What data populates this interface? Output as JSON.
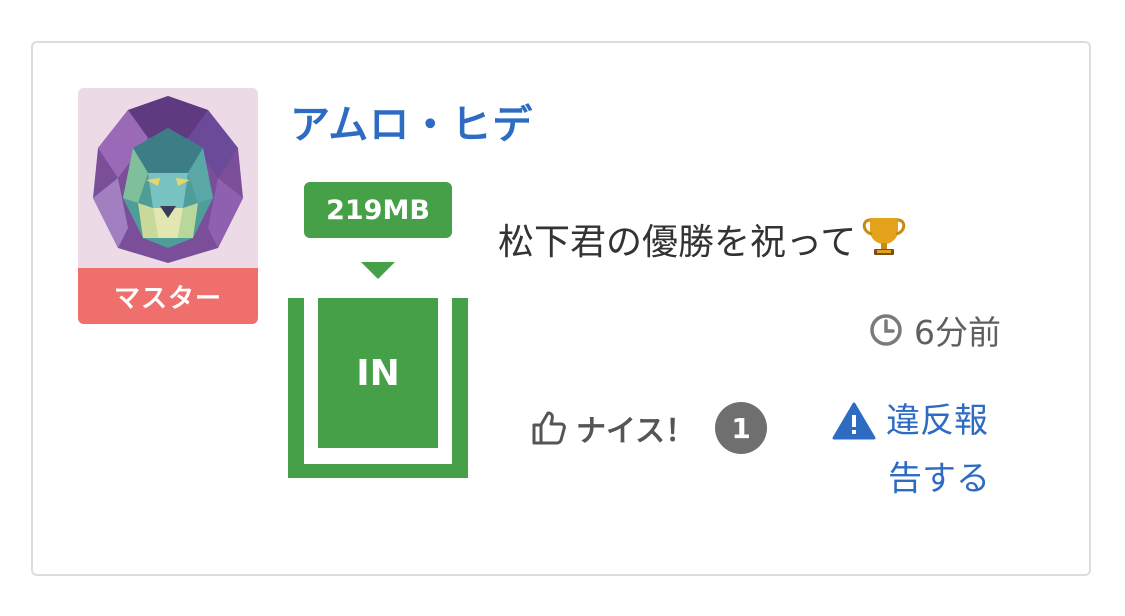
{
  "post": {
    "username": "アムロ・ヒデ",
    "rank_badge": "マスター",
    "size_badge": "219MB",
    "status_label": "IN",
    "message": "松下君の優勝を祝って",
    "message_emoji": "🏆",
    "timestamp": "6分前",
    "nice_label": "ナイス！",
    "nice_count": "1",
    "report_line1": "違反報",
    "report_line2": "告する"
  },
  "icons": {
    "clock": "clock-icon",
    "thumbs_up": "thumbs-up-icon",
    "warning": "warning-triangle-icon",
    "trophy": "trophy-icon"
  },
  "colors": {
    "link_blue": "#2e6cc4",
    "green": "#45a047",
    "rank_red": "#ee6f6b",
    "count_gray": "#6f6f6f"
  }
}
